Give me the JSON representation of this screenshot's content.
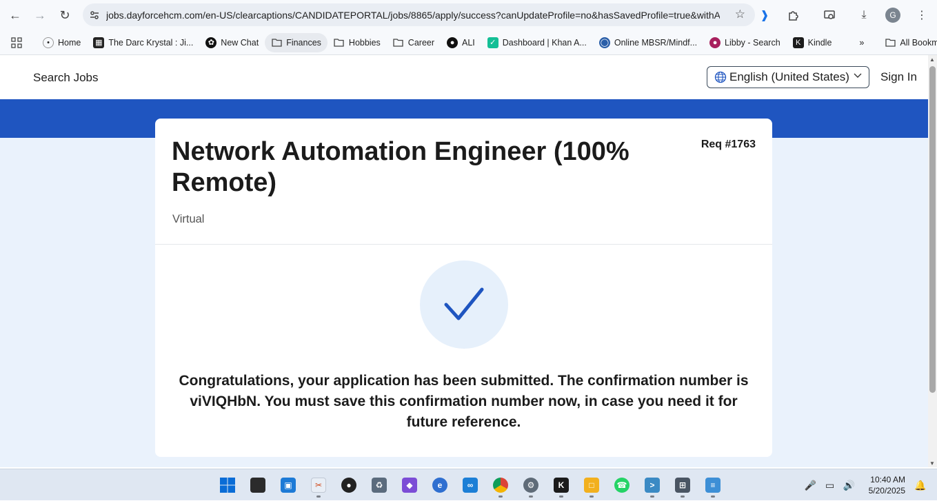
{
  "browser": {
    "url": "jobs.dayforcehcm.com/en-US/clearcaptions/CANDIDATEPORTAL/jobs/8865/apply/success?canUpdateProfile=no&hasSavedProfile=true&withA...",
    "profile_initial": "G"
  },
  "bookmarks": {
    "items": [
      {
        "label": "Home",
        "icon": "home-icon"
      },
      {
        "label": "The Darc Krystal : Ji...",
        "icon": "site-icon"
      },
      {
        "label": "New Chat",
        "icon": "chat-icon"
      },
      {
        "label": "Finances",
        "icon": "folder-icon"
      },
      {
        "label": "Hobbies",
        "icon": "folder-icon"
      },
      {
        "label": "Career",
        "icon": "folder-icon"
      },
      {
        "label": "ALI",
        "icon": "github-icon"
      },
      {
        "label": "Dashboard | Khan A...",
        "icon": "khan-icon"
      },
      {
        "label": "Online MBSR/Mindf...",
        "icon": "globe-icon"
      },
      {
        "label": "Libby - Search",
        "icon": "libby-icon"
      },
      {
        "label": "Kindle",
        "icon": "kindle-icon"
      }
    ],
    "all_bookmarks_label": "All Bookmarks"
  },
  "site_header": {
    "search_jobs": "Search Jobs",
    "language": "English (United States)",
    "sign_in": "Sign In"
  },
  "job": {
    "title": "Network Automation Engineer (100% Remote)",
    "req": "Req #1763",
    "location": "Virtual"
  },
  "confirmation": {
    "message": "Congratulations, your application has been submitted. The confirmation number is viVIQHbN. You must save this confirmation number now, in case you need it for future reference."
  },
  "taskbar": {
    "time": "10:40 AM",
    "date": "5/20/2025"
  },
  "colors": {
    "brand_blue": "#1f55c0",
    "page_bg": "#eaf2fc",
    "check_blue": "#1f55c0"
  }
}
